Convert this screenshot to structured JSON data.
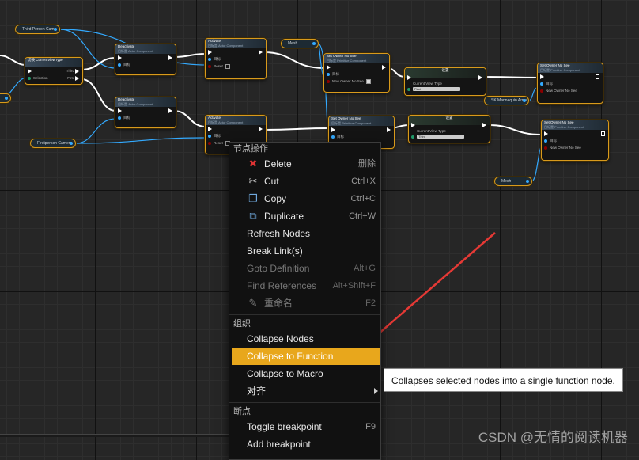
{
  "canvas": {
    "vars": {
      "third_person_cam": "Third Person Cam",
      "first_person_camera": "Firstperson Camera",
      "mesh_top": "Mesh",
      "mesh_bottom": "Mesh",
      "sk_mannequin_arms": "SK Mannequin Arms"
    },
    "nodes": {
      "switch": {
        "title": "切换 CurrentViewType",
        "pin_selection": "Selection",
        "pin_third": "Third",
        "pin_first": "First"
      },
      "deactivate_top": {
        "title": "Deactivate",
        "subtitle": "目标是 Actor Component",
        "pin_target": "目标"
      },
      "deactivate_bottom": {
        "title": "Deactivate",
        "subtitle": "目标是 Actor Component",
        "pin_target": "目标"
      },
      "activate_top": {
        "title": "Activate",
        "subtitle": "目标是 Actor Component",
        "pin_target": "目标",
        "pin_reset": "Reset"
      },
      "activate_bottom": {
        "title": "Activate",
        "subtitle": "目标是 Actor Component",
        "pin_target": "目标",
        "pin_reset": "Reset"
      },
      "set_owner_1": {
        "title": "Set Owner No See",
        "subtitle": "目标是 Primitive Component",
        "pin_target": "目标",
        "pin_value": "New Owner No See"
      },
      "set_owner_2": {
        "title": "Set Owner No See",
        "subtitle": "目标是 Primitive Component",
        "pin_target": "目标",
        "pin_value": "New Owner No See"
      },
      "set_owner_3": {
        "title": "Set Owner No See",
        "subtitle": "目标是 Primitive Component",
        "pin_target": "目标"
      },
      "set_owner_4": {
        "title": "Set Owner No See",
        "subtitle": "目标是 Primitive Component",
        "pin_target": "目标",
        "pin_value": "New Owner No See"
      },
      "set_top": {
        "title": "设置",
        "pin": "Current View Type",
        "value": "First"
      },
      "set_bottom": {
        "title": "设置",
        "pin": "Current View Type",
        "value": "Third"
      }
    }
  },
  "menu": {
    "section_node": "节点操作",
    "delete": {
      "label": "Delete",
      "shortcut": "删除"
    },
    "cut": {
      "label": "Cut",
      "shortcut": "Ctrl+X"
    },
    "copy": {
      "label": "Copy",
      "shortcut": "Ctrl+C"
    },
    "duplicate": {
      "label": "Duplicate",
      "shortcut": "Ctrl+W"
    },
    "refresh": {
      "label": "Refresh Nodes"
    },
    "break_links": {
      "label": "Break Link(s)"
    },
    "goto_def": {
      "label": "Goto Definition",
      "shortcut": "Alt+G"
    },
    "find_refs": {
      "label": "Find References",
      "shortcut": "Alt+Shift+F"
    },
    "rename": {
      "label": "重命名",
      "shortcut": "F2"
    },
    "section_org": "组织",
    "collapse_nodes": {
      "label": "Collapse Nodes"
    },
    "collapse_function": {
      "label": "Collapse to Function"
    },
    "collapse_macro": {
      "label": "Collapse to Macro"
    },
    "align": {
      "label": "对齐"
    },
    "section_breakpoint": "断点",
    "toggle_bp": {
      "label": "Toggle breakpoint",
      "shortcut": "F9"
    },
    "add_bp": {
      "label": "Add breakpoint"
    }
  },
  "tooltip": "Collapses selected nodes into a single function node.",
  "watermark": "CSDN @无情的阅读机器",
  "colors": {
    "accent": "#e8a71c",
    "selection_border": "#d89a1c",
    "data_wire": "#33aaff",
    "annotation_arrow": "#e53935"
  }
}
